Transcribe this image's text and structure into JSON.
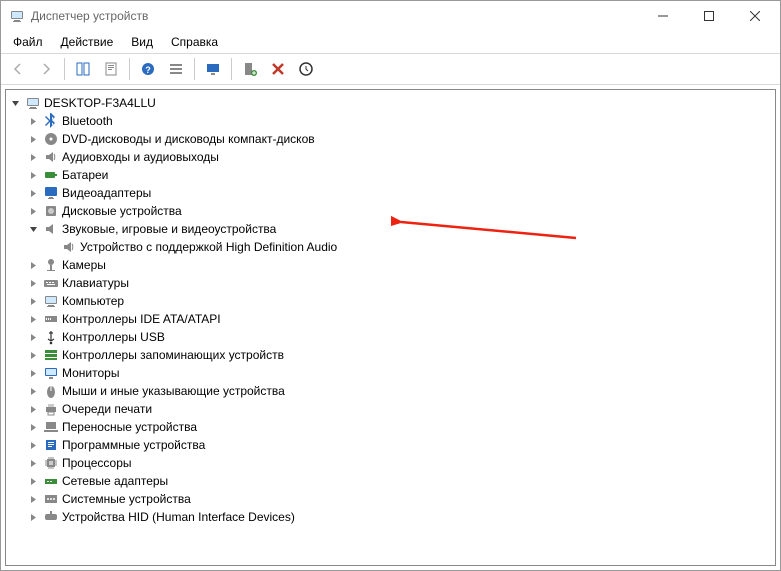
{
  "window": {
    "title": "Диспетчер устройств"
  },
  "menu": {
    "file": "Файл",
    "action": "Действие",
    "view": "Вид",
    "help": "Справка"
  },
  "toolbar_tooltips": {
    "back": "Назад",
    "forward": "Вперёд",
    "show_hidden": "Показать/скрыть панель",
    "properties": "Свойства",
    "help": "Справка",
    "details": "Подробности",
    "monitor": "Обновить конфигурацию оборудования",
    "add": "Добавить устаревшее оборудование",
    "remove": "Удалить устройство",
    "scan": "Обновить"
  },
  "tree": {
    "root_icon": "computer-icon",
    "root": "DESKTOP-F3A4LLU",
    "nodes": [
      {
        "icon": "bluetooth-icon",
        "label": "Bluetooth",
        "expanded": false
      },
      {
        "icon": "dvd-icon",
        "label": "DVD-дисководы и дисководы компакт-дисков",
        "expanded": false
      },
      {
        "icon": "audio-icon",
        "label": "Аудиовходы и аудиовыходы",
        "expanded": false
      },
      {
        "icon": "battery-icon",
        "label": "Батареи",
        "expanded": false
      },
      {
        "icon": "display-icon",
        "label": "Видеоадаптеры",
        "expanded": false
      },
      {
        "icon": "disk-icon",
        "label": "Дисковые устройства",
        "expanded": false
      },
      {
        "icon": "sound-icon",
        "label": "Звуковые, игровые и видеоустройства",
        "expanded": true,
        "children": [
          {
            "icon": "speaker-icon",
            "label": "Устройство с поддержкой High Definition Audio"
          }
        ]
      },
      {
        "icon": "camera-icon",
        "label": "Камеры",
        "expanded": false
      },
      {
        "icon": "keyboard-icon",
        "label": "Клавиатуры",
        "expanded": false
      },
      {
        "icon": "computer-small-icon",
        "label": "Компьютер",
        "expanded": false
      },
      {
        "icon": "ide-icon",
        "label": "Контроллеры IDE ATA/ATAPI",
        "expanded": false
      },
      {
        "icon": "usb-icon",
        "label": "Контроллеры USB",
        "expanded": false
      },
      {
        "icon": "storage-controller-icon",
        "label": "Контроллеры запоминающих устройств",
        "expanded": false
      },
      {
        "icon": "monitor-icon",
        "label": "Мониторы",
        "expanded": false
      },
      {
        "icon": "mouse-icon",
        "label": "Мыши и иные указывающие устройства",
        "expanded": false
      },
      {
        "icon": "printer-icon",
        "label": "Очереди печати",
        "expanded": false
      },
      {
        "icon": "laptop-icon",
        "label": "Переносные устройства",
        "expanded": false
      },
      {
        "icon": "software-icon",
        "label": "Программные устройства",
        "expanded": false
      },
      {
        "icon": "cpu-icon",
        "label": "Процессоры",
        "expanded": false
      },
      {
        "icon": "network-icon",
        "label": "Сетевые адаптеры",
        "expanded": false
      },
      {
        "icon": "system-icon",
        "label": "Системные устройства",
        "expanded": false
      },
      {
        "icon": "hid-icon",
        "label": "Устройства HID (Human Interface Devices)",
        "expanded": false
      }
    ]
  }
}
